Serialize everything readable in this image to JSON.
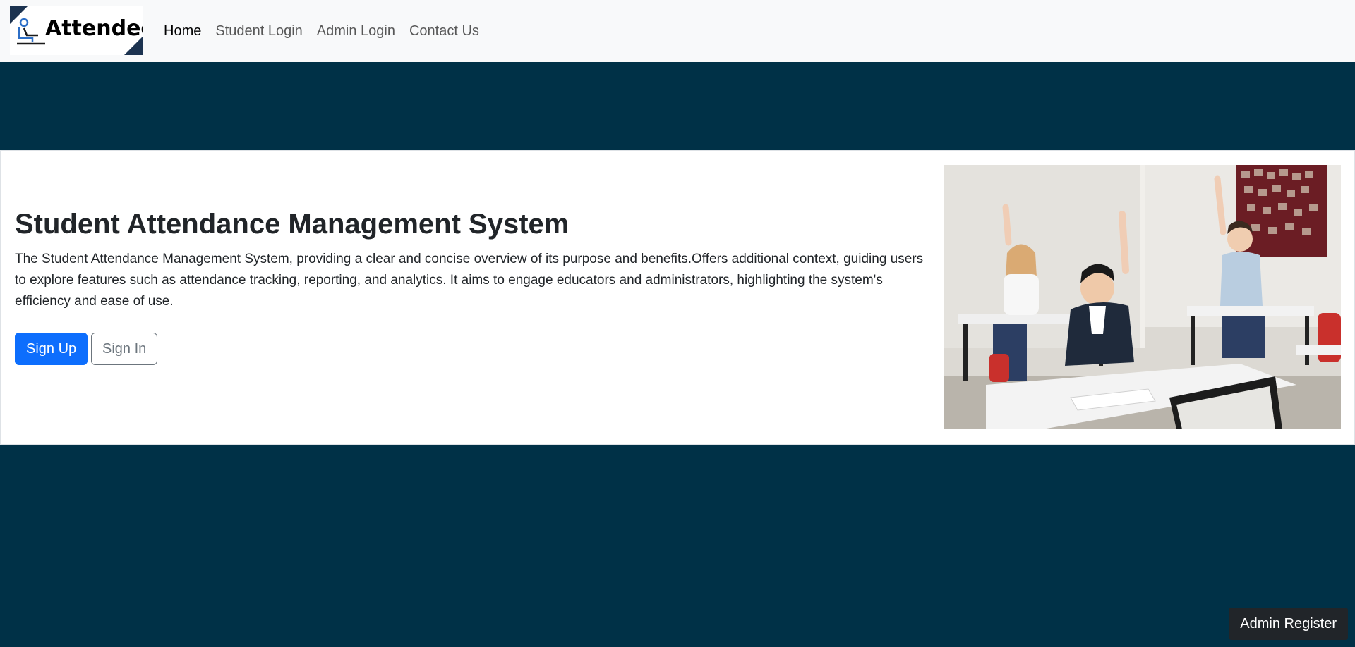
{
  "navbar": {
    "brand": "Attendee",
    "links": [
      {
        "label": "Home",
        "active": true
      },
      {
        "label": "Student Login",
        "active": false
      },
      {
        "label": "Admin Login",
        "active": false
      },
      {
        "label": "Contact Us",
        "active": false
      }
    ]
  },
  "hero": {
    "title": "Student Attendance Management System",
    "description": "The Student Attendance Management System, providing a clear and concise overview of its purpose and benefits.Offers additional context, guiding users to explore features such as attendance tracking, reporting, and analytics. It aims to engage educators and administrators, highlighting the system's efficiency and ease of use.",
    "signup_label": "Sign Up",
    "signin_label": "Sign In",
    "image_icon": "classroom-photo"
  },
  "fab": {
    "label": "Admin Register"
  },
  "colors": {
    "background": "#003147",
    "navbar": "#f8f9fa",
    "primary": "#0d6efd",
    "secondary": "#6c757d",
    "dark": "#212529"
  }
}
